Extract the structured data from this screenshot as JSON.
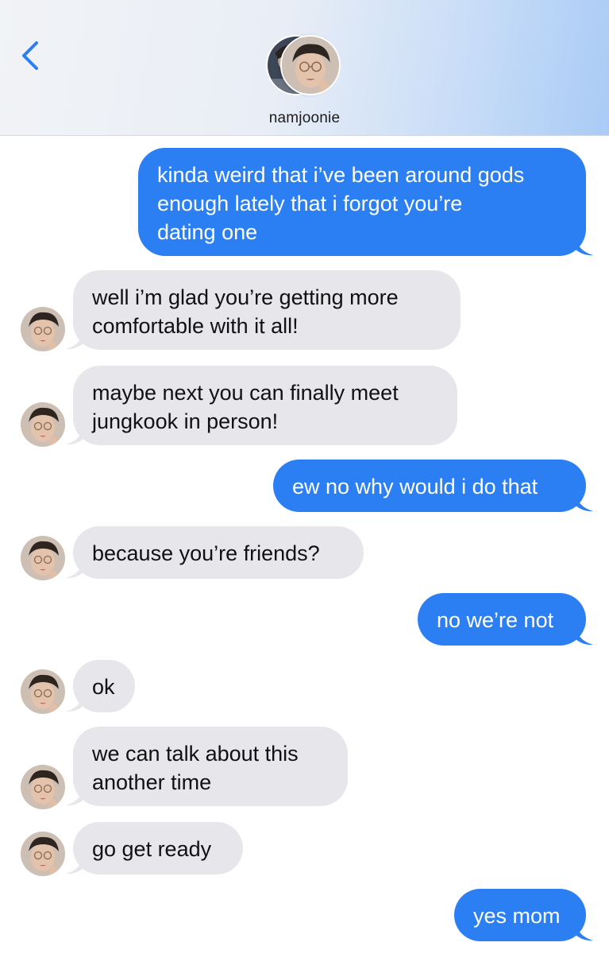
{
  "header": {
    "back_icon": "chevron-left-icon",
    "contact_name": "namjoonie",
    "accent_color": "#2b7ff2"
  },
  "messages": [
    {
      "from": "me",
      "lines": [
        "kinda weird that i’ve been around gods",
        "enough lately that i forgot you’re",
        "dating one"
      ]
    },
    {
      "from": "contact",
      "lines": [
        "well i’m glad you’re getting more",
        "comfortable with it all!"
      ]
    },
    {
      "from": "contact",
      "lines": [
        "maybe next you can finally meet",
        "jungkook in person!"
      ]
    },
    {
      "from": "me",
      "lines": [
        "ew no why would i do that"
      ]
    },
    {
      "from": "contact",
      "lines": [
        "because you’re friends?"
      ]
    },
    {
      "from": "me",
      "lines": [
        "no we’re not"
      ]
    },
    {
      "from": "contact",
      "lines": [
        "ok"
      ]
    },
    {
      "from": "contact",
      "lines": [
        "we can talk about this",
        "another time"
      ]
    },
    {
      "from": "contact",
      "lines": [
        "go get ready"
      ]
    },
    {
      "from": "me",
      "lines": [
        "yes mom"
      ]
    }
  ],
  "colors": {
    "sent_bubble": "#2b7ff2",
    "received_bubble": "#e6e6eb"
  }
}
